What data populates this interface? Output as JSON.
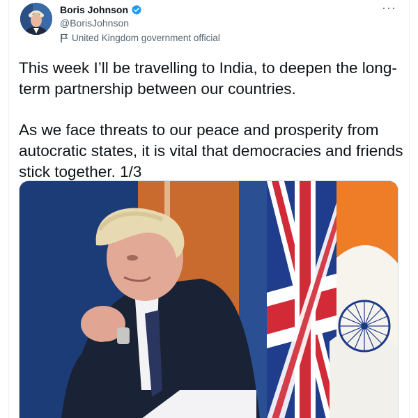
{
  "tweet": {
    "author": {
      "display_name": "Boris Johnson",
      "handle": "@BorisJohnson",
      "verified": true,
      "label": "United Kingdom government official"
    },
    "text": [
      "This week I’ll be travelling to India, to deepen the long-term partnership between our countries.",
      "As we face threats to our peace and prosperity from autocratic states, it is vital that democracies and friends stick together. 1/3"
    ]
  },
  "colors": {
    "verified_badge": "#1d9bf0",
    "text_primary": "#0f1419",
    "text_secondary": "#536471"
  },
  "icons": {
    "verified": "verified-badge-icon",
    "label": "flag-icon",
    "more": "more-options-icon"
  }
}
